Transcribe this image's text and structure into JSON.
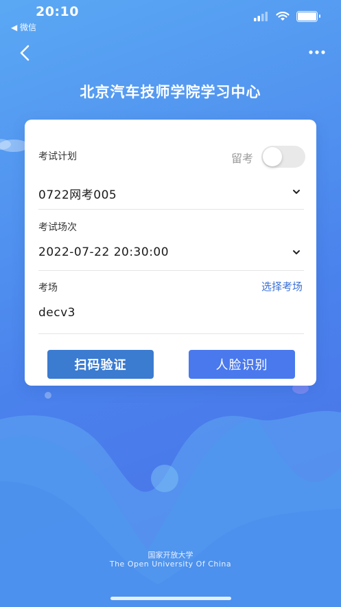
{
  "status": {
    "time": "20:10",
    "back_app": "◀ 微信"
  },
  "nav": {
    "title": "北京汽车技师学院学习中心"
  },
  "form": {
    "plan_label": "考试计划",
    "plan_value": "0722网考005",
    "retake_label": "留考",
    "session_label": "考试场次",
    "session_value": "2022-07-22 20:30:00",
    "venue_label": "考场",
    "venue_select_label": "选择考场",
    "venue_value": "decv3",
    "scan_button": "扫码验证",
    "face_button": "人脸识别"
  },
  "footer": {
    "cn": "国家开放大学",
    "en": "The Open University Of China"
  },
  "colors": {
    "bg_start": "#5aa8f4",
    "bg_end": "#4a6ee8",
    "scan_btn": "#3b7bd0",
    "face_btn": "#4a79ee",
    "link": "#3a70d6"
  },
  "icons": [
    "signal-icon",
    "wifi-icon",
    "battery-icon",
    "back-arrow-icon",
    "more-icon",
    "chevron-down-icon"
  ]
}
